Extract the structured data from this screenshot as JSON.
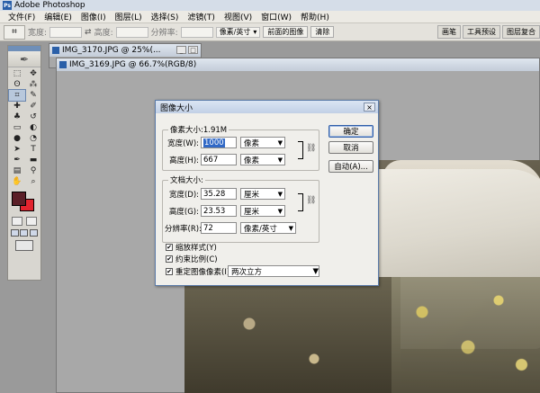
{
  "app": {
    "title": "Adobe Photoshop"
  },
  "menu": [
    "文件(F)",
    "编辑(E)",
    "图像(I)",
    "图层(L)",
    "选择(S)",
    "滤镜(T)",
    "视图(V)",
    "窗口(W)",
    "帮助(H)"
  ],
  "options_bar": {
    "width_label": "宽度:",
    "height_label": "高度:",
    "resolution_label": "分辨率:",
    "unit": "像素/英寸",
    "front_image": "前面的图像",
    "clear": "清除",
    "tabs": [
      "画笔",
      "工具预设",
      "图层复合"
    ]
  },
  "documents": [
    {
      "title": "IMG_3170.JPG @ 25%(..."
    },
    {
      "title": "IMG_3169.JPG @ 66.7%(RGB/8)"
    }
  ],
  "colors": {
    "foreground": "#5b1f28",
    "background": "#e1242f",
    "accent": "#2f5ea8"
  },
  "dialog": {
    "title": "图像大小",
    "close": "×",
    "pixel_dims": {
      "legend": "像素大小:1.91M",
      "width_label": "宽度(W):",
      "width_value": "1000",
      "width_unit": "像素",
      "height_label": "高度(H):",
      "height_value": "667",
      "height_unit": "像素"
    },
    "doc_size": {
      "legend": "文档大小:",
      "width_label": "宽度(D):",
      "width_value": "35.28",
      "width_unit": "厘米",
      "height_label": "高度(G):",
      "height_value": "23.53",
      "height_unit": "厘米",
      "resolution_label": "分辨率(R):",
      "resolution_value": "72",
      "resolution_unit": "像素/英寸"
    },
    "buttons": {
      "ok": "确定",
      "cancel": "取消",
      "auto": "自动(A)..."
    },
    "checkboxes": {
      "scale_styles": "缩放样式(Y)",
      "constrain": "约束比例(C)",
      "resample": "重定图像像素(I):"
    },
    "resample_method": "两次立方"
  }
}
